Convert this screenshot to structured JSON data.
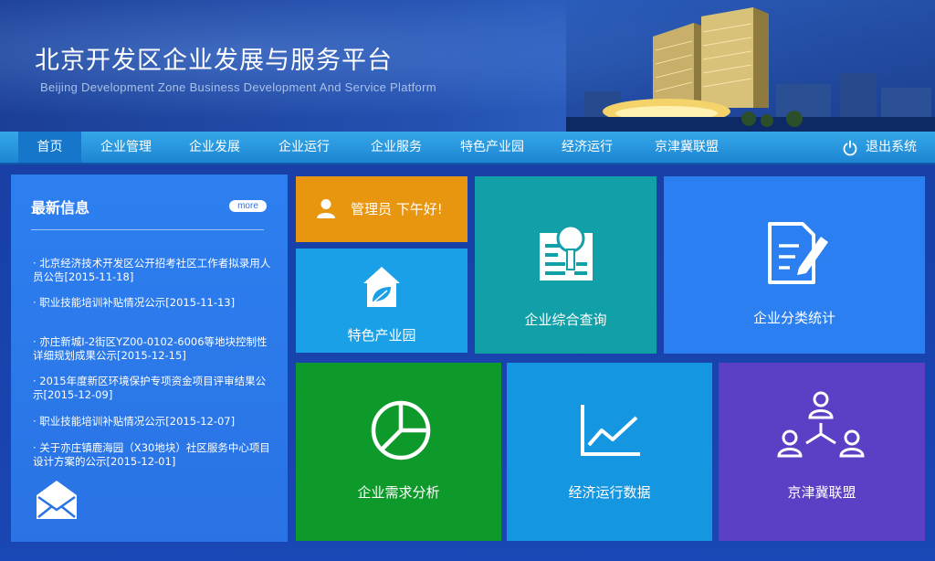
{
  "header": {
    "title_cn": "北京开发区企业发展与服务平台",
    "title_en": "Beijing Development Zone Business Development And Service Platform"
  },
  "nav": {
    "items": [
      {
        "label": "首页",
        "active": true
      },
      {
        "label": "企业管理"
      },
      {
        "label": "企业发展"
      },
      {
        "label": "企业运行"
      },
      {
        "label": "企业服务"
      },
      {
        "label": "特色产业园"
      },
      {
        "label": "经济运行"
      },
      {
        "label": "京津冀联盟"
      }
    ],
    "logout_label": "退出系统",
    "logout_icon": "power-icon"
  },
  "news": {
    "title": "最新信息",
    "more_label": "more",
    "items": [
      "· 北京经济技术开发区公开招考社区工作者拟录用人员公告[2015-11-18]",
      "· 职业技能培训补贴情况公示[2015-11-13]",
      "· 亦庄新城I-2街区YZ00-0102-6006等地块控制性详细规划成果公示[2015-12-15]",
      "· 2015年度新区环境保护专项资金项目评审结果公示[2015-12-09]",
      "· 职业技能培训补贴情况公示[2015-12-07]",
      "· 关于亦庄镇鹿海园（X30地块）社区服务中心项目设计方案的公示[2015-12-01]"
    ],
    "icon": "envelope-icon"
  },
  "tiles": {
    "greeting": "管理员 下午好!",
    "park": "特色产业园",
    "query": "企业综合查询",
    "stats": "企业分类统计",
    "demand": "企业需求分析",
    "econ": "经济运行数据",
    "alliance": "京津冀联盟"
  },
  "colors": {
    "greeting_bg": "#e8960f",
    "park_bg": "#1aa0e6",
    "query_bg": "#12a0a8",
    "stats_bg": "#2b7ff0",
    "demand_bg": "#0e9a2a",
    "econ_bg": "#1596e0",
    "alliance_bg": "#5b3fc4"
  }
}
